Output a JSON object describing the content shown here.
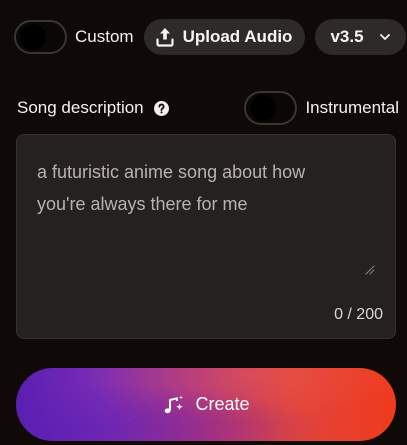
{
  "header": {
    "custom_label": "Custom",
    "upload_label": "Upload Audio",
    "version_label": "v3.5",
    "custom_toggle_on": false
  },
  "description": {
    "label": "Song description",
    "instrumental_label": "Instrumental",
    "instrumental_toggle_on": false,
    "text": "a futuristic anime song about how you're always there for me",
    "char_count": "0 / 200"
  },
  "create": {
    "label": "Create"
  },
  "icons": {
    "upload": "upload-icon",
    "version_chevron": "chevron-down-icon",
    "help": "question-circle-icon",
    "create": "music-sparkle-icon"
  },
  "colors": {
    "background": "#0f0a08",
    "pill_bg": "#2e2a29",
    "textarea_bg": "#242120",
    "create_gradient_start": "#5a1fb0",
    "create_gradient_end": "#ef3a1c"
  }
}
